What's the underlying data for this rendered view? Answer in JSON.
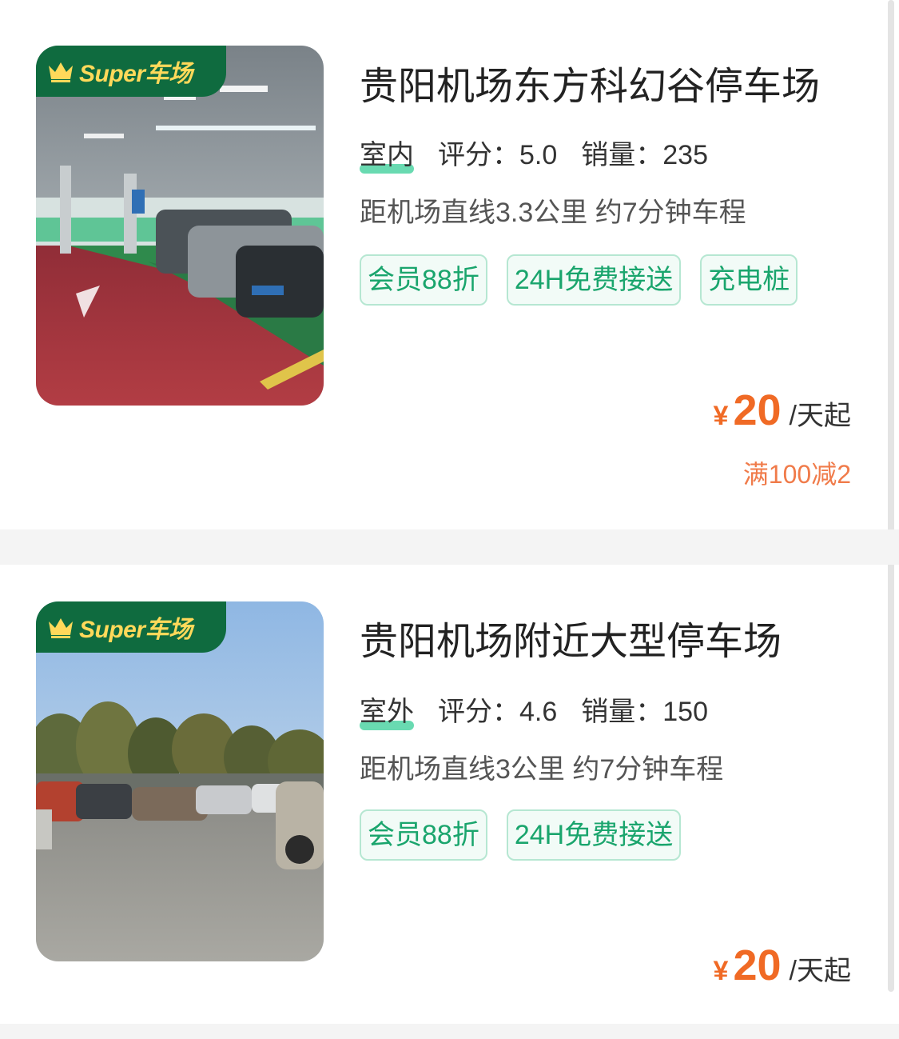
{
  "badge": {
    "text": "Super车场",
    "icon": "crown-icon"
  },
  "colors": {
    "brand_green": "#0f6b3f",
    "badge_text": "#ffd95a",
    "tag_text": "#1aa56d",
    "tag_border": "#b6e7d2",
    "price": "#f06a25",
    "promo": "#f07b4a"
  },
  "lots": [
    {
      "name": "贵阳机场东方科幻谷停车场",
      "type": "室内",
      "rating_label": "评分：",
      "rating": "5.0",
      "sales_label": "销量：",
      "sales": "235",
      "distance": "距机场直线3.3公里 约7分钟车程",
      "tags": [
        "会员88折",
        "24H免费接送",
        "充电桩"
      ],
      "currency": "¥",
      "price": "20",
      "price_unit": "/天起",
      "promo": "满100减2"
    },
    {
      "name": "贵阳机场附近大型停车场",
      "type": "室外",
      "rating_label": "评分：",
      "rating": "4.6",
      "sales_label": "销量：",
      "sales": "150",
      "distance": "距机场直线3公里 约7分钟车程",
      "tags": [
        "会员88折",
        "24H免费接送"
      ],
      "currency": "¥",
      "price": "20",
      "price_unit": "/天起"
    }
  ]
}
